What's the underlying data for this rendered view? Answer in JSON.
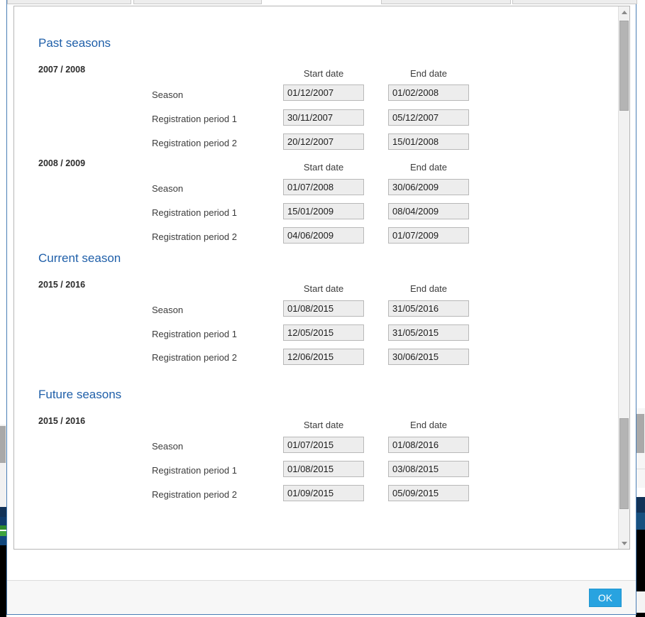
{
  "dialog": {
    "footer": {
      "ok_label": "OK"
    }
  },
  "columns": {
    "start": "Start date",
    "end": "End date"
  },
  "row_labels": {
    "season": "Season",
    "reg1": "Registration period 1",
    "reg2": "Registration period 2"
  },
  "colors": {
    "section_heading": "#1f5fa9",
    "ok_button": "#28a3e0",
    "field_background": "#ededed",
    "field_border": "#b8b8b8",
    "dialog_border": "#4a7eb5"
  },
  "sections": [
    {
      "title": "Past seasons",
      "seasons": [
        {
          "label": "2007 / 2008",
          "rows": [
            {
              "label": "Season",
              "start": "01/12/2007",
              "end": "01/02/2008"
            },
            {
              "label": "Registration period 1",
              "start": "30/11/2007",
              "end": "05/12/2007"
            },
            {
              "label": "Registration period 2",
              "start": "20/12/2007",
              "end": "15/01/2008"
            }
          ]
        },
        {
          "label": "2008 / 2009",
          "rows": [
            {
              "label": "Season",
              "start": "01/07/2008",
              "end": "30/06/2009"
            },
            {
              "label": "Registration period 1",
              "start": "15/01/2009",
              "end": "08/04/2009"
            },
            {
              "label": "Registration period 2",
              "start": "04/06/2009",
              "end": "01/07/2009"
            }
          ]
        }
      ]
    },
    {
      "title": "Current season",
      "seasons": [
        {
          "label": "2015 / 2016",
          "rows": [
            {
              "label": "Season",
              "start": "01/08/2015",
              "end": "31/05/2016"
            },
            {
              "label": "Registration period 1",
              "start": "12/05/2015",
              "end": "31/05/2015"
            },
            {
              "label": "Registration period 2",
              "start": "12/06/2015",
              "end": "30/06/2015"
            }
          ]
        }
      ]
    },
    {
      "title": "Future seasons",
      "seasons": [
        {
          "label": "2015 / 2016",
          "rows": [
            {
              "label": "Season",
              "start": "01/07/2015",
              "end": "01/08/2016"
            },
            {
              "label": "Registration period 1",
              "start": "01/08/2015",
              "end": "03/08/2015"
            },
            {
              "label": "Registration period 2",
              "start": "01/09/2015",
              "end": "05/09/2015"
            }
          ]
        }
      ]
    }
  ],
  "scrollbar": {
    "up_arrow": "scroll-up-arrow",
    "down_arrow": "scroll-down-arrow"
  }
}
